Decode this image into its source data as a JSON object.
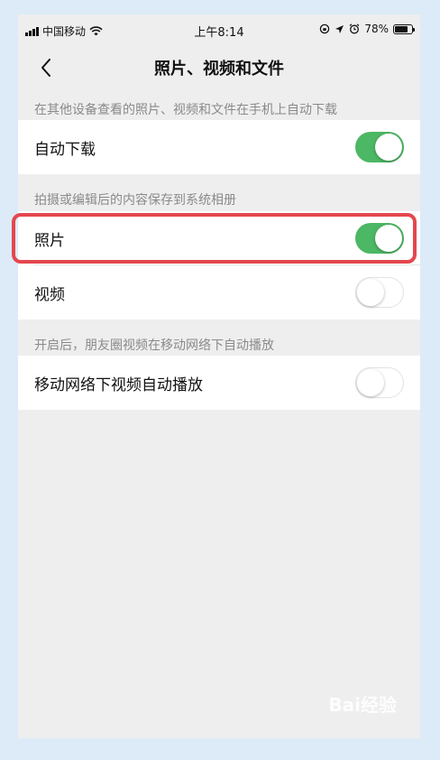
{
  "status_bar": {
    "carrier": "中国移动",
    "time": "上午8:14",
    "battery_percent": "78%",
    "battery_level": 0.78
  },
  "nav": {
    "title": "照片、视频和文件"
  },
  "sections": {
    "download_hint": "在其他设备查看的照片、视频和文件在手机上自动下载",
    "save_hint": "拍摄或编辑后的内容保存到系统相册",
    "autoplay_hint": "开启后，朋友圈视频在移动网络下自动播放"
  },
  "rows": {
    "auto_download": {
      "label": "自动下载",
      "on": true
    },
    "photos": {
      "label": "照片",
      "on": true
    },
    "videos": {
      "label": "视频",
      "on": false
    },
    "autoplay": {
      "label": "移动网络下视频自动播放",
      "on": false
    }
  },
  "colors": {
    "toggle_on": "#4cb764",
    "highlight": "#e4474f",
    "frame": "#dcebf7"
  },
  "watermark": {
    "text": "Bai经验"
  }
}
